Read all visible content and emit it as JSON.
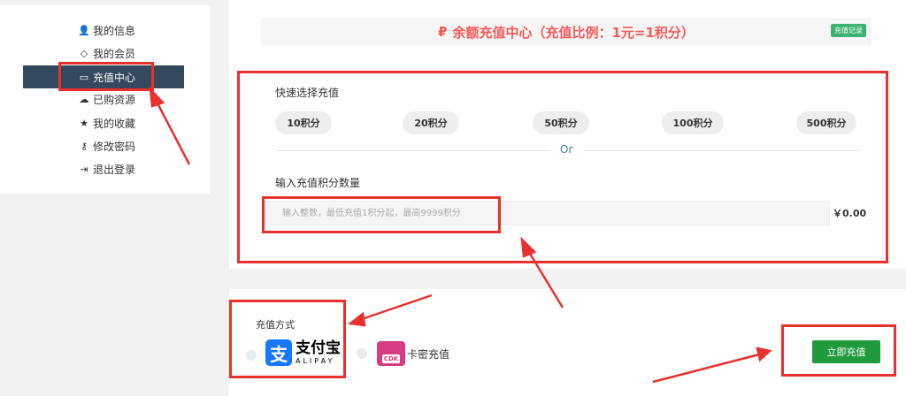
{
  "sidebar": {
    "items": [
      {
        "label": "我的信息",
        "icon": "user-icon"
      },
      {
        "label": "我的会员",
        "icon": "diamond-icon"
      },
      {
        "label": "充值中心",
        "icon": "card-icon",
        "active": true
      },
      {
        "label": "已购资源",
        "icon": "cloud-download-icon"
      },
      {
        "label": "我的收藏",
        "icon": "star-icon"
      },
      {
        "label": "修改密码",
        "icon": "key-icon"
      },
      {
        "label": "退出登录",
        "icon": "logout-icon"
      }
    ]
  },
  "banner": {
    "title": "余额充值中心（充值比例：1元=1积分）",
    "history_label": "充值记录"
  },
  "quick": {
    "label": "快速选择充值",
    "options": [
      "10积分",
      "20积分",
      "50积分",
      "100积分",
      "500积分"
    ],
    "or": "Or"
  },
  "custom": {
    "label": "输入充值积分数量",
    "placeholder": "输入整数，最低充值1积分起，最高9999积分",
    "price": "￥0.00"
  },
  "payment": {
    "label": "充值方式",
    "alipay_cn": "支付宝",
    "alipay_en": "ALIPAY",
    "cdk_badge": "CDK",
    "cdk_label": "卡密充值",
    "submit": "立即充值"
  },
  "colors": {
    "accent": "#f55a5a",
    "sidebar_active": "#34495e",
    "submit": "#1f9a3c",
    "annotation": "#e8312d"
  }
}
